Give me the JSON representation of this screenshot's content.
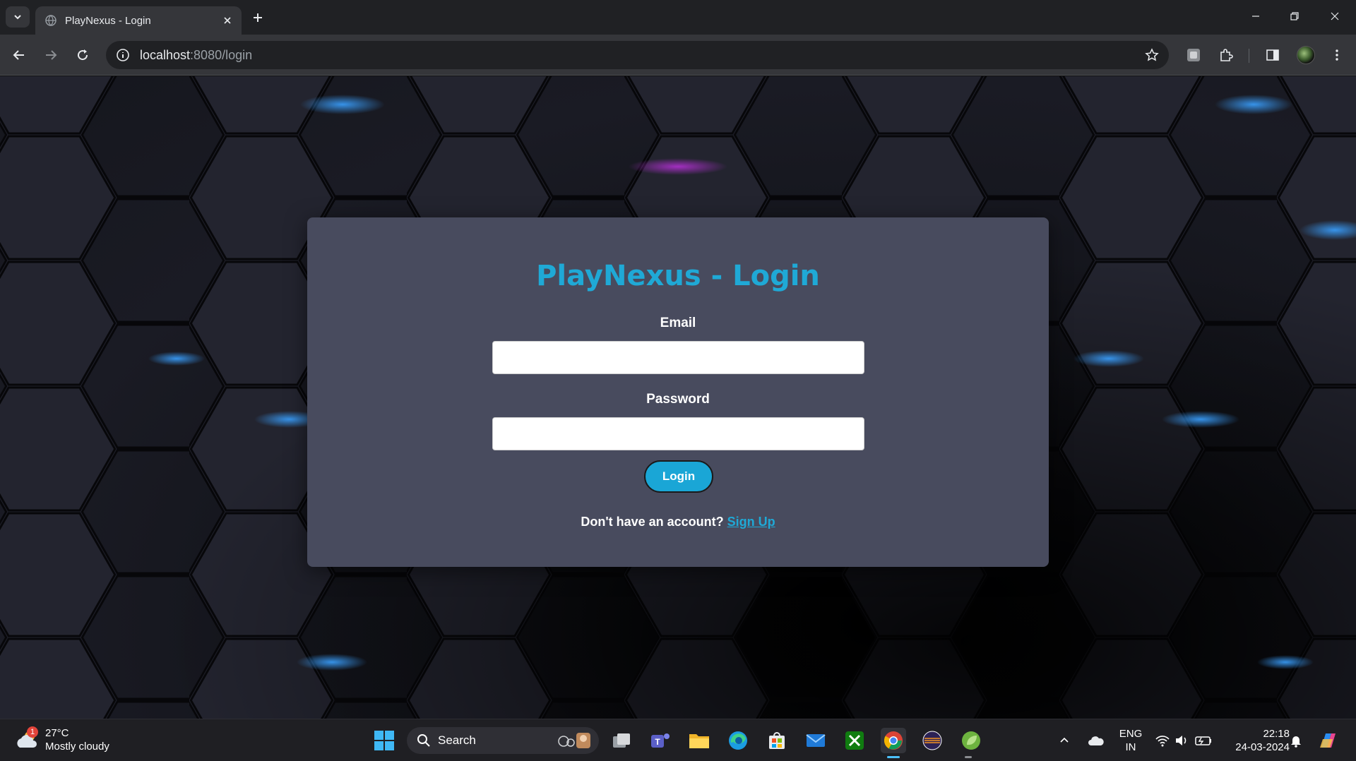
{
  "browser": {
    "tab_title": "PlayNexus - Login",
    "url_host": "localhost",
    "url_rest": ":8080/login"
  },
  "page": {
    "title": "PlayNexus - Login",
    "email_label": "Email",
    "email_value": "",
    "password_label": "Password",
    "password_value": "",
    "login_button": "Login",
    "signup_prompt": "Don't have an account?",
    "signup_link": "Sign Up",
    "accent_color": "#1fa9d6"
  },
  "taskbar": {
    "weather_temp": "27°C",
    "weather_desc": "Mostly cloudy",
    "weather_badge": "1",
    "search_placeholder": "Search",
    "lang_top": "ENG",
    "lang_bottom": "IN",
    "time": "22:18",
    "date": "24-03-2024"
  }
}
